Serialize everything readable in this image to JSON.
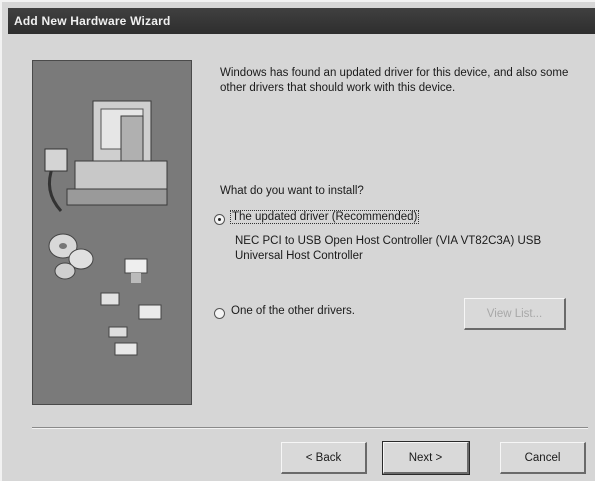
{
  "window": {
    "title": "Add New Hardware Wizard"
  },
  "content": {
    "intro": "Windows has found an updated driver for this device, and also some other drivers that should work with this device.",
    "question": "What do you want to install?",
    "option_updated": {
      "label": "The updated driver (Recommended)",
      "device": "NEC PCI to USB Open Host Controller (VIA VT82C3A) USB Universal Host Controller",
      "selected": true
    },
    "option_other": {
      "label": "One of the other drivers.",
      "selected": false
    },
    "details_button": "View List..."
  },
  "footer": {
    "back_label": "< Back",
    "next_label": "Next >",
    "cancel_label": "Cancel"
  }
}
